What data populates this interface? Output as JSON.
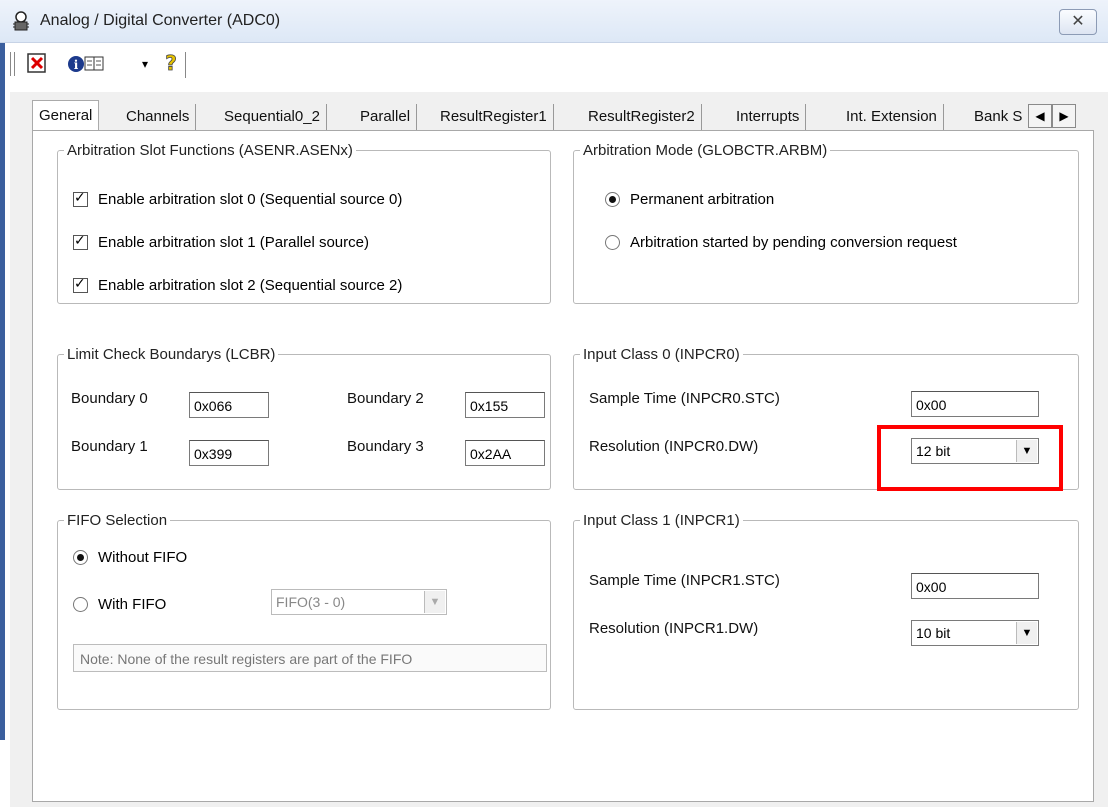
{
  "window": {
    "title": "Analog / Digital Converter  (ADC0)",
    "close_symbol": "✕",
    "icon": "chip-person-icon"
  },
  "toolbar": {
    "buttons": [
      {
        "name": "clear-button",
        "icon": "red-x-document-icon",
        "symbol": "✖"
      },
      {
        "name": "info-button",
        "icon": "info-books-icon",
        "symbol": "ℹ"
      },
      {
        "name": "dropdown-arrow",
        "icon": "chevron-down-icon",
        "symbol": "▾"
      },
      {
        "name": "help-button",
        "icon": "question-mark-icon",
        "symbol": "?"
      }
    ]
  },
  "tabs": [
    {
      "label": "General",
      "active": true
    },
    {
      "label": "Channels"
    },
    {
      "label": "Sequential0_2"
    },
    {
      "label": "Parallel"
    },
    {
      "label": "ResultRegister1"
    },
    {
      "label": "ResultRegister2"
    },
    {
      "label": "Interrupts"
    },
    {
      "label": "Int. Extension"
    },
    {
      "label": "Bank S"
    }
  ],
  "tab_scroll": {
    "left": "◀",
    "right": "▶"
  },
  "arbitration_slots": {
    "title": "Arbitration Slot Functions (ASENR.ASENx)",
    "items": [
      {
        "label": "Enable arbitration slot 0 (Sequential source 0)",
        "checked": true
      },
      {
        "label": "Enable arbitration slot 1 (Parallel source)",
        "checked": true
      },
      {
        "label": "Enable arbitration slot 2 (Sequential source 2)",
        "checked": true
      }
    ],
    "check_mark": "✓"
  },
  "arbitration_mode": {
    "title": "Arbitration Mode (GLOBCTR.ARBM)",
    "options": [
      {
        "label": "Permanent arbitration",
        "selected": true
      },
      {
        "label": "Arbitration started by pending conversion request",
        "selected": false
      }
    ]
  },
  "limit_check": {
    "title": "Limit Check Boundarys (LCBR)",
    "boundary0": {
      "label": "Boundary 0",
      "value": "0x066"
    },
    "boundary1": {
      "label": "Boundary 1",
      "value": "0x399"
    },
    "boundary2": {
      "label": "Boundary 2",
      "value": "0x155"
    },
    "boundary3": {
      "label": "Boundary 3",
      "value": "0x2AA"
    }
  },
  "input_class0": {
    "title": "Input Class 0 (INPCR0)",
    "sample_label": "Sample Time  (INPCR0.STC)",
    "sample_value": "0x00",
    "resolution_label": "Resolution  (INPCR0.DW)",
    "resolution_value": "12 bit",
    "highlight_color": "#ff0000"
  },
  "fifo": {
    "title": "FIFO Selection",
    "without_label": "Without FIFO",
    "without_selected": true,
    "with_label": "With FIFO",
    "with_selected": false,
    "fifo_select_value": "FIFO(3 - 0)",
    "note": "Note: None of the result registers are part of the FIFO"
  },
  "input_class1": {
    "title": "Input Class 1 (INPCR1)",
    "sample_label": "Sample Time  (INPCR1.STC)",
    "sample_value": "0x00",
    "resolution_label": "Resolution  (INPCR1.DW)",
    "resolution_value": "10 bit"
  },
  "dropdown_arrow": "▼"
}
